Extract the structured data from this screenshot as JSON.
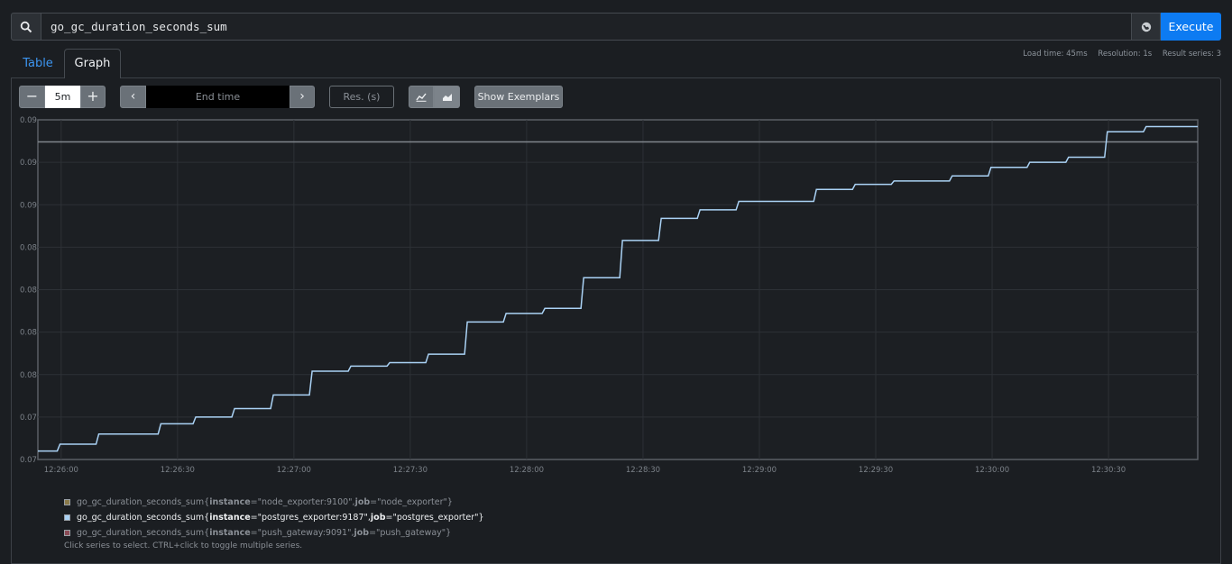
{
  "query": {
    "value": "go_gc_duration_seconds_sum"
  },
  "toolbar": {
    "execute_label": "Execute",
    "search_icon": "search-icon",
    "metrics_icon": "globe-icon"
  },
  "tabs": [
    {
      "label": "Table",
      "active": false
    },
    {
      "label": "Graph",
      "active": true
    }
  ],
  "stats": {
    "load_time": "Load time: 45ms",
    "resolution": "Resolution: 1s",
    "result_series": "Result series: 3"
  },
  "controls": {
    "range": "5m",
    "end_time_placeholder": "End time",
    "res_placeholder": "Res. (s)",
    "show_exemplars": "Show Exemplars",
    "minus_label": "−",
    "plus_label": "+",
    "prev_label": "‹",
    "next_label": "›"
  },
  "chart_data": {
    "type": "line",
    "y_tick_labels": [
      "0.09",
      "0.09",
      "0.09",
      "0.08",
      "0.08",
      "0.08",
      "0.08",
      "0.07",
      "0.07"
    ],
    "x_tick_labels": [
      "12:26:00",
      "12:26:30",
      "12:27:00",
      "12:27:30",
      "12:28:00",
      "12:28:30",
      "12:29:00",
      "12:29:30",
      "12:30:00",
      "12:30:30"
    ],
    "x_tick_seconds": [
      0,
      30,
      60,
      90,
      120,
      150,
      180,
      210,
      240,
      270
    ],
    "x_range_seconds": [
      -6,
      293
    ],
    "ylim": [
      0.07,
      0.09
    ],
    "reference_line": 0.0887,
    "series": [
      {
        "color": "#aad2f5",
        "steps": [
          [
            -6,
            0.0705
          ],
          [
            -1,
            0.0709
          ],
          [
            9,
            0.0715
          ],
          [
            25,
            0.0721
          ],
          [
            34,
            0.0725
          ],
          [
            44,
            0.073
          ],
          [
            54,
            0.0738
          ],
          [
            64,
            0.0752
          ],
          [
            74,
            0.0755
          ],
          [
            84,
            0.0757
          ],
          [
            94,
            0.0762
          ],
          [
            104,
            0.0781
          ],
          [
            114,
            0.0786
          ],
          [
            124,
            0.0789
          ],
          [
            134,
            0.0807
          ],
          [
            144,
            0.0829
          ],
          [
            154,
            0.0842
          ],
          [
            164,
            0.0847
          ],
          [
            174,
            0.0852
          ],
          [
            194,
            0.0859
          ],
          [
            204,
            0.0862
          ],
          [
            214,
            0.0864
          ],
          [
            229,
            0.0867
          ],
          [
            239,
            0.0872
          ],
          [
            249,
            0.0875
          ],
          [
            259,
            0.0878
          ],
          [
            269,
            0.0893
          ],
          [
            279,
            0.0896
          ]
        ]
      }
    ]
  },
  "legend": [
    {
      "metric": "go_gc_duration_seconds_sum",
      "open": "{",
      "k1": "instance",
      "v1": "=\"node_exporter:9100\", ",
      "k2": "job",
      "v2": "=\"node_exporter\"",
      "close": "}",
      "color": "#8a7a4a",
      "state": "dim"
    },
    {
      "metric": "go_gc_duration_seconds_sum",
      "open": "{",
      "k1": "instance",
      "v1": "=\"postgres_exporter:9187\", ",
      "k2": "job",
      "v2": "=\"postgres_exporter\"",
      "close": "}",
      "color": "#aad2f5",
      "state": "active"
    },
    {
      "metric": "go_gc_duration_seconds_sum",
      "open": "{",
      "k1": "instance",
      "v1": "=\"push_gateway:9091\", ",
      "k2": "job",
      "v2": "=\"push_gateway\"",
      "close": "}",
      "color": "#8a4a55",
      "state": "dim"
    }
  ],
  "footnote": "Click series to select. CTRL+click to toggle multiple series."
}
